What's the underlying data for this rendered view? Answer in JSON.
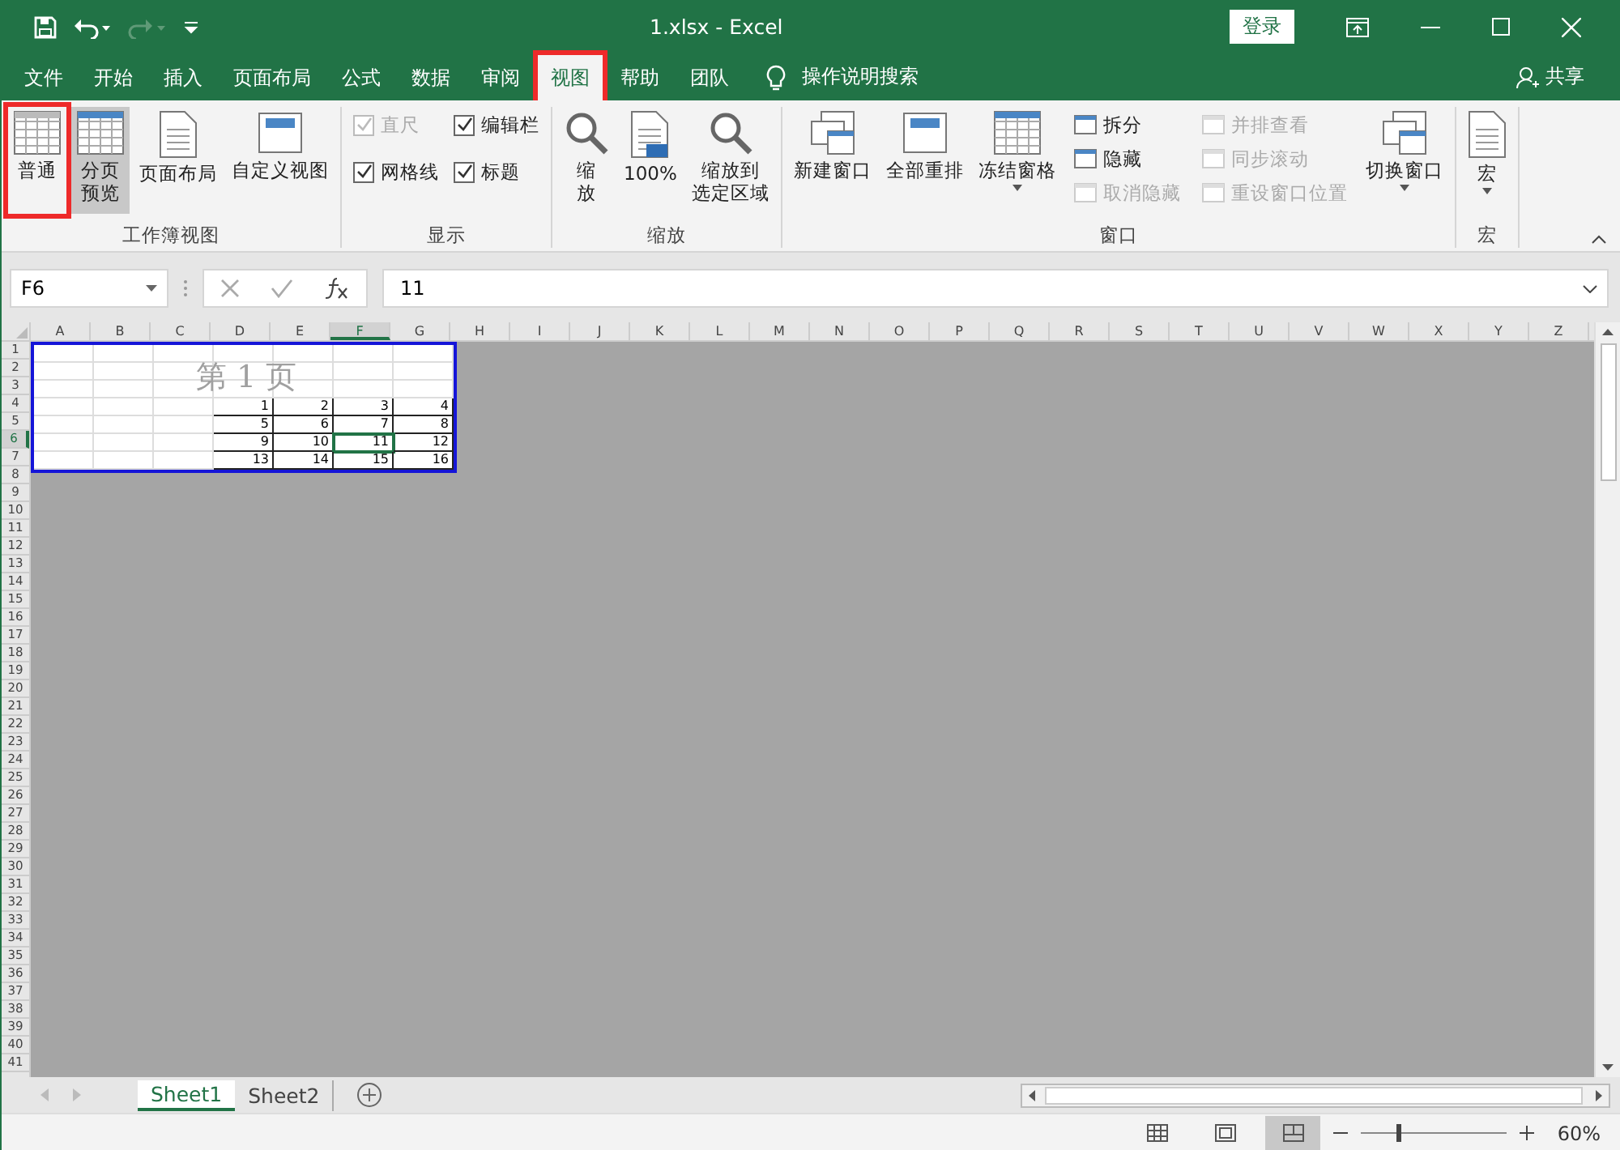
{
  "title_bar": {
    "title": "1.xlsx - Excel",
    "sign_in": "登录"
  },
  "tabs": [
    {
      "label": "文件",
      "selected": false,
      "highlighted": false
    },
    {
      "label": "开始",
      "selected": false,
      "highlighted": false
    },
    {
      "label": "插入",
      "selected": false,
      "highlighted": false
    },
    {
      "label": "页面布局",
      "selected": false,
      "highlighted": false
    },
    {
      "label": "公式",
      "selected": false,
      "highlighted": false
    },
    {
      "label": "数据",
      "selected": false,
      "highlighted": false
    },
    {
      "label": "审阅",
      "selected": false,
      "highlighted": false
    },
    {
      "label": "视图",
      "selected": true,
      "highlighted": true
    },
    {
      "label": "帮助",
      "selected": false,
      "highlighted": false
    },
    {
      "label": "团队",
      "selected": false,
      "highlighted": false
    }
  ],
  "tell_me": "操作说明搜索",
  "share": "共享",
  "ribbon": [
    {
      "label": "工作簿视图",
      "items": [
        {
          "kind": "large",
          "label": "普通",
          "selected": false,
          "highlighted": true
        },
        {
          "kind": "large",
          "label": [
            "分页",
            "预览"
          ],
          "selected": true,
          "highlighted": false
        },
        {
          "kind": "large",
          "label": "页面布局",
          "selected": false,
          "highlighted": false
        },
        {
          "kind": "large",
          "label": "自定义视图",
          "selected": false,
          "highlighted": false
        }
      ]
    },
    {
      "label": "显示",
      "items": [
        {
          "kind": "check",
          "label": "直尺",
          "checked": true,
          "disabled": true
        },
        {
          "kind": "check",
          "label": "网格线",
          "checked": true,
          "disabled": false
        },
        {
          "kind": "check",
          "label": "编辑栏",
          "checked": true,
          "disabled": false
        },
        {
          "kind": "check",
          "label": "标题",
          "checked": true,
          "disabled": false
        }
      ]
    },
    {
      "label": "缩放",
      "items": [
        {
          "kind": "large",
          "label": [
            "缩",
            "放"
          ],
          "selected": false,
          "highlighted": false
        },
        {
          "kind": "large",
          "label": "100%",
          "selected": false,
          "highlighted": false
        },
        {
          "kind": "large",
          "label": [
            "缩放到",
            "选定区域"
          ],
          "selected": false,
          "highlighted": false
        }
      ]
    },
    {
      "label": "窗口",
      "items": [
        {
          "kind": "large",
          "label": "新建窗口",
          "selected": false,
          "highlighted": false
        },
        {
          "kind": "large",
          "label": "全部重排",
          "selected": false,
          "highlighted": false
        },
        {
          "kind": "large",
          "label": "冻结窗格",
          "selected": false,
          "highlighted": false,
          "dropdown": true
        },
        {
          "kind": "small",
          "label": "拆分",
          "disabled": false
        },
        {
          "kind": "small",
          "label": "隐藏",
          "disabled": false
        },
        {
          "kind": "small",
          "label": "取消隐藏",
          "disabled": true
        },
        {
          "kind": "small",
          "label": "并排查看",
          "disabled": true
        },
        {
          "kind": "small",
          "label": "同步滚动",
          "disabled": true
        },
        {
          "kind": "small",
          "label": "重设窗口位置",
          "disabled": true
        },
        {
          "kind": "large",
          "label": "切换窗口",
          "selected": false,
          "highlighted": false,
          "dropdown": true
        }
      ]
    },
    {
      "label": "宏",
      "items": [
        {
          "kind": "large",
          "label": "宏",
          "selected": false,
          "highlighted": false,
          "dropdown": true
        }
      ]
    }
  ],
  "formula_bar": {
    "name_box": "F6",
    "formula": "11"
  },
  "sheet": {
    "columns": [
      {
        "label": "A",
        "selected": false
      },
      {
        "label": "B",
        "selected": false
      },
      {
        "label": "C",
        "selected": false
      },
      {
        "label": "D",
        "selected": false
      },
      {
        "label": "E",
        "selected": false
      },
      {
        "label": "F",
        "selected": true
      },
      {
        "label": "G",
        "selected": false
      },
      {
        "label": "H",
        "selected": false
      },
      {
        "label": "I",
        "selected": false
      },
      {
        "label": "J",
        "selected": false
      },
      {
        "label": "K",
        "selected": false
      },
      {
        "label": "L",
        "selected": false
      },
      {
        "label": "M",
        "selected": false
      },
      {
        "label": "N",
        "selected": false
      },
      {
        "label": "O",
        "selected": false
      },
      {
        "label": "P",
        "selected": false
      },
      {
        "label": "Q",
        "selected": false
      },
      {
        "label": "R",
        "selected": false
      },
      {
        "label": "S",
        "selected": false
      },
      {
        "label": "T",
        "selected": false
      },
      {
        "label": "U",
        "selected": false
      },
      {
        "label": "V",
        "selected": false
      },
      {
        "label": "W",
        "selected": false
      },
      {
        "label": "X",
        "selected": false
      },
      {
        "label": "Y",
        "selected": false
      },
      {
        "label": "Z",
        "selected": false
      }
    ],
    "rows": [
      {
        "label": "1",
        "selected": false
      },
      {
        "label": "2",
        "selected": false
      },
      {
        "label": "3",
        "selected": false
      },
      {
        "label": "4",
        "selected": false
      },
      {
        "label": "5",
        "selected": false
      },
      {
        "label": "6",
        "selected": true
      },
      {
        "label": "7",
        "selected": false
      },
      {
        "label": "8",
        "selected": false
      },
      {
        "label": "9",
        "selected": false
      },
      {
        "label": "10",
        "selected": false
      },
      {
        "label": "11",
        "selected": false
      },
      {
        "label": "12",
        "selected": false
      },
      {
        "label": "13",
        "selected": false
      },
      {
        "label": "14",
        "selected": false
      },
      {
        "label": "15",
        "selected": false
      },
      {
        "label": "16",
        "selected": false
      },
      {
        "label": "17",
        "selected": false
      },
      {
        "label": "18",
        "selected": false
      },
      {
        "label": "19",
        "selected": false
      },
      {
        "label": "20",
        "selected": false
      },
      {
        "label": "21",
        "selected": false
      },
      {
        "label": "22",
        "selected": false
      },
      {
        "label": "23",
        "selected": false
      },
      {
        "label": "24",
        "selected": false
      },
      {
        "label": "25",
        "selected": false
      },
      {
        "label": "26",
        "selected": false
      },
      {
        "label": "27",
        "selected": false
      },
      {
        "label": "28",
        "selected": false
      },
      {
        "label": "29",
        "selected": false
      },
      {
        "label": "30",
        "selected": false
      },
      {
        "label": "31",
        "selected": false
      },
      {
        "label": "32",
        "selected": false
      },
      {
        "label": "33",
        "selected": false
      },
      {
        "label": "34",
        "selected": false
      },
      {
        "label": "35",
        "selected": false
      },
      {
        "label": "36",
        "selected": false
      },
      {
        "label": "37",
        "selected": false
      },
      {
        "label": "38",
        "selected": false
      },
      {
        "label": "39",
        "selected": false
      },
      {
        "label": "40",
        "selected": false
      },
      {
        "label": "41",
        "selected": false
      }
    ],
    "page_label": "第 1 页",
    "data_rows": [
      [
        "1",
        "2",
        "3",
        "4"
      ],
      [
        "5",
        "6",
        "7",
        "8"
      ],
      [
        "9",
        "10",
        "11",
        "12"
      ],
      [
        "13",
        "14",
        "15",
        "16"
      ]
    ]
  },
  "sheet_tabs": [
    {
      "label": "Sheet1",
      "selected": true
    },
    {
      "label": "Sheet2",
      "selected": false
    }
  ],
  "status_bar": {
    "views": [
      {
        "selected": false
      },
      {
        "selected": false
      },
      {
        "selected": true
      }
    ],
    "zoom": {
      "level": 0.25
    },
    "zoom_text": "60%"
  }
}
